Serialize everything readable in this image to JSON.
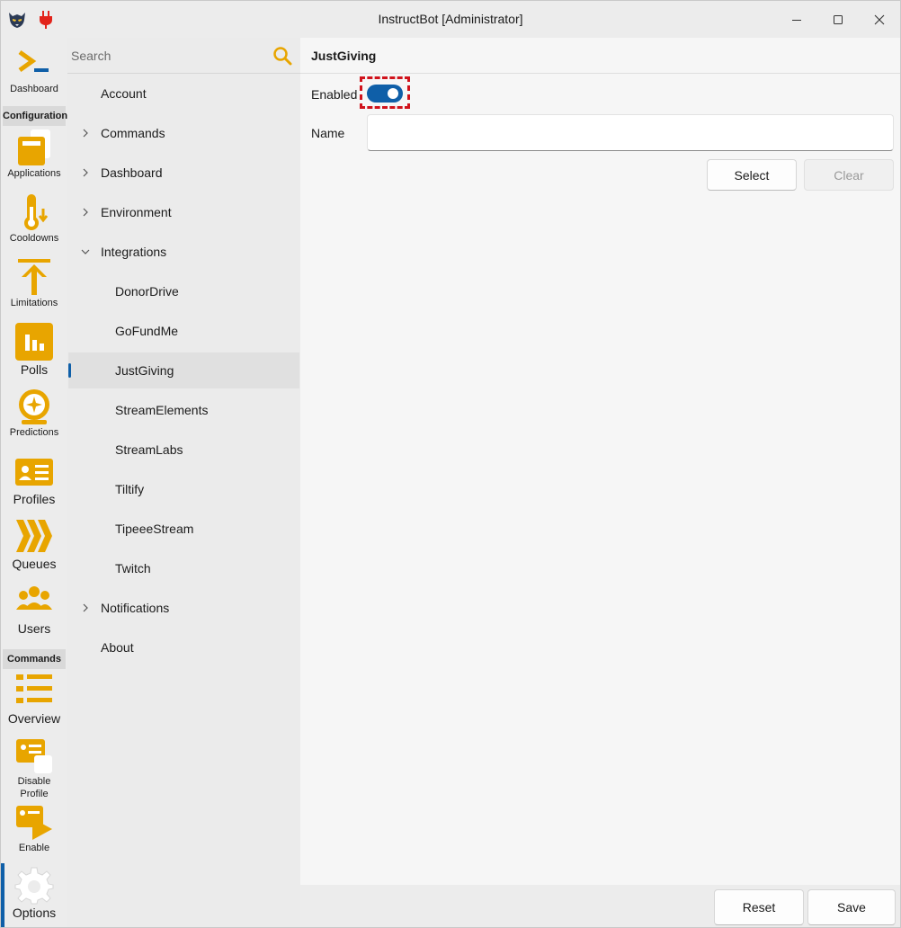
{
  "window": {
    "title": "InstructBot [Administrator]"
  },
  "rail": {
    "dashboard": "Dashboard",
    "section_configuration": "Configuration",
    "applications": "Applications",
    "cooldowns": "Cooldowns",
    "limitations": "Limitations",
    "polls": "Polls",
    "predictions": "Predictions",
    "profiles": "Profiles",
    "queues": "Queues",
    "users": "Users",
    "section_commands": "Commands",
    "overview": "Overview",
    "disable_profile_1": "Disable",
    "disable_profile_2": "Profile",
    "enable": "Enable",
    "options": "Options"
  },
  "nav": {
    "search_placeholder": "Search",
    "items": [
      {
        "label": "Account"
      },
      {
        "label": "Commands"
      },
      {
        "label": "Dashboard"
      },
      {
        "label": "Environment"
      },
      {
        "label": "Integrations"
      },
      {
        "label": "DonorDrive"
      },
      {
        "label": "GoFundMe"
      },
      {
        "label": "JustGiving"
      },
      {
        "label": "StreamElements"
      },
      {
        "label": "StreamLabs"
      },
      {
        "label": "Tiltify"
      },
      {
        "label": "TipeeeStream"
      },
      {
        "label": "Twitch"
      },
      {
        "label": "Notifications"
      },
      {
        "label": "About"
      }
    ]
  },
  "content": {
    "title": "JustGiving",
    "enabled_label": "Enabled",
    "name_label": "Name",
    "name_value": "",
    "select_label": "Select",
    "clear_label": "Clear",
    "reset_label": "Reset",
    "save_label": "Save"
  },
  "colors": {
    "accent": "#0f5fa8",
    "icon_gold": "#e8a500",
    "highlight_dashed": "#d0121b"
  }
}
